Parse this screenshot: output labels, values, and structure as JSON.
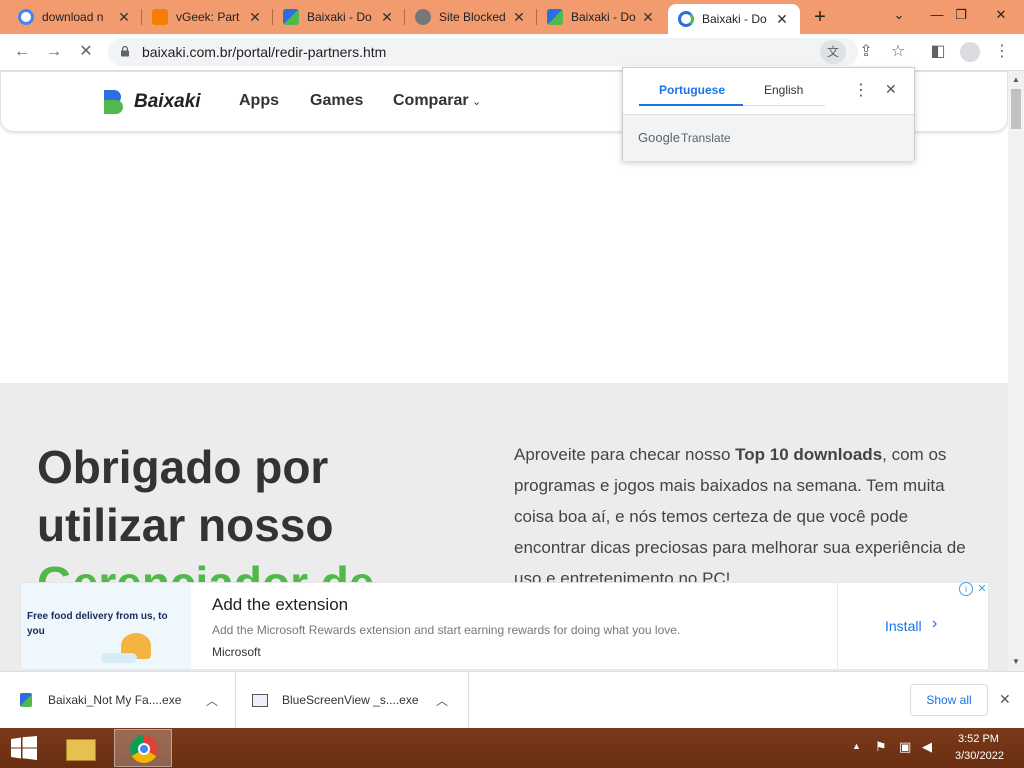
{
  "tabs": [
    {
      "title": "download n",
      "favicon": "google-icon"
    },
    {
      "title": "vGeek: Part",
      "favicon": "blogger-icon"
    },
    {
      "title": "Baixaki - Do",
      "favicon": "baixaki-icon"
    },
    {
      "title": "Site Blocked",
      "favicon": "globe-icon"
    },
    {
      "title": "Baixaki - Do",
      "favicon": "baixaki-icon"
    },
    {
      "title": "Baixaki - Do",
      "favicon": "baixaki-icon",
      "active": true
    }
  ],
  "address": {
    "url": "baixaki.com.br/portal/redir-partners.htm"
  },
  "site": {
    "logo_text": "Baixaki",
    "nav": [
      "Apps",
      "Games",
      "Comparar"
    ]
  },
  "hero": {
    "headline_line1": "Obrigado por",
    "headline_line2": "utilizar nosso",
    "headline_line3": "Gerenciador de",
    "body_prefix": "Aproveite para checar nosso ",
    "body_bold": "Top 10 downloads",
    "body_suffix": ", com os programas e jogos mais baixados na semana. Tem muita coisa boa aí, e nós temos certeza de que você pode encontrar dicas preciosas para melhorar sua experiência de uso e entretenimento no PC!"
  },
  "translate": {
    "lang_source": "Portuguese",
    "lang_target": "English",
    "brand_google": "Google",
    "brand_translate": "Translate"
  },
  "ad": {
    "image_caption": "Free food delivery from us, to you",
    "title": "Add the extension",
    "description": "Add the Microsoft Rewards extension and start earning rewards for doing what you love.",
    "advertiser": "Microsoft",
    "cta": "Install"
  },
  "downloads": {
    "items": [
      "Baixaki_Not My Fa....exe",
      "BlueScreenView _s....exe"
    ],
    "show_all": "Show all"
  },
  "taskbar": {
    "time": "3:52 PM",
    "date": "3/30/2022"
  },
  "colors": {
    "tabstrip": "#f29b6e",
    "brand_green": "#51b84b",
    "link_blue": "#1a73e8",
    "taskbar": "#6a2e12"
  }
}
